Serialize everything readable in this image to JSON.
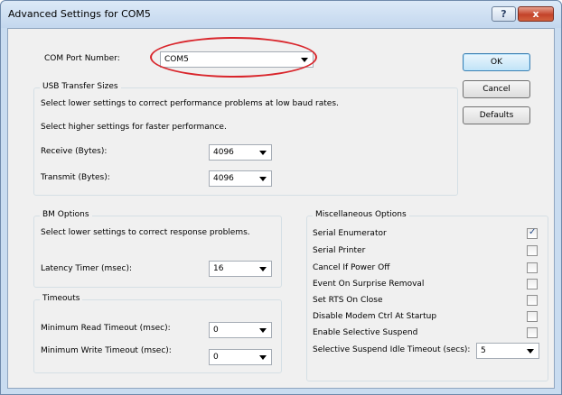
{
  "window": {
    "title": "Advanced Settings for COM5"
  },
  "titlebar_buttons": {
    "help": "?",
    "close": "x"
  },
  "com_port": {
    "label": "COM Port Number:",
    "value": "COM5"
  },
  "usb": {
    "title": "USB Transfer Sizes",
    "desc1": "Select lower settings to correct performance problems at low baud rates.",
    "desc2": "Select higher settings for faster performance.",
    "receive_label": "Receive (Bytes):",
    "receive_value": "4096",
    "transmit_label": "Transmit (Bytes):",
    "transmit_value": "4096"
  },
  "bm": {
    "title": "BM Options",
    "desc": "Select lower settings to correct response problems.",
    "latency_label": "Latency Timer (msec):",
    "latency_value": "16"
  },
  "timeouts": {
    "title": "Timeouts",
    "read_label": "Minimum Read Timeout (msec):",
    "read_value": "0",
    "write_label": "Minimum Write Timeout (msec):",
    "write_value": "0"
  },
  "misc": {
    "title": "Miscellaneous Options",
    "serial_enumerator": {
      "label": "Serial Enumerator",
      "checked": true
    },
    "serial_printer": {
      "label": "Serial Printer",
      "checked": false
    },
    "cancel_power_off": {
      "label": "Cancel If Power Off",
      "checked": false
    },
    "event_surprise": {
      "label": "Event On Surprise Removal",
      "checked": false
    },
    "set_rts": {
      "label": "Set RTS On Close",
      "checked": false
    },
    "disable_modem": {
      "label": "Disable Modem Ctrl At Startup",
      "checked": false
    },
    "selective_suspend": {
      "label": "Enable Selective Suspend",
      "checked": false
    },
    "suspend_timeout_label": "Selective Suspend Idle Timeout (secs):",
    "suspend_timeout_value": "5"
  },
  "buttons": {
    "ok": "OK",
    "cancel": "Cancel",
    "defaults": "Defaults"
  },
  "colors": {
    "highlight": "#d9262c",
    "close_button": "#c4432a",
    "checkmark": "#2a4f8a"
  }
}
